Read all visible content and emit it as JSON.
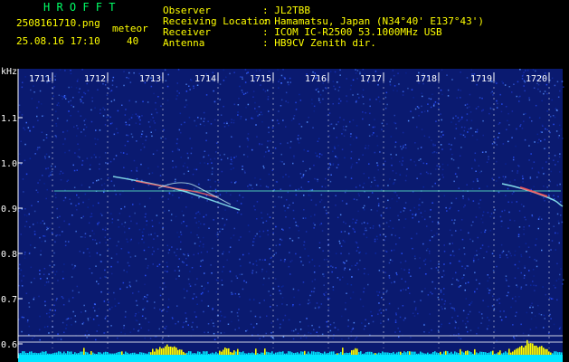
{
  "header": {
    "brand": "H R O F F T",
    "filename": "2508161710.png",
    "datetime": "25.08.16 17:10",
    "meteor_label": "meteor",
    "meteor_count": "40",
    "info": [
      {
        "key": "Observer",
        "value": ": JL2TBB"
      },
      {
        "key": "Receiving Location",
        "value": ": Hamamatsu, Japan (N34°40' E137°43')"
      },
      {
        "key": "Receiver",
        "value": ": ICOM IC-R2500 53.1000MHz USB"
      },
      {
        "key": "Antenna",
        "value": ": HB9CV Zenith dir."
      }
    ]
  },
  "axis": {
    "y_unit": "kHz",
    "y_ticks": [
      "1.1",
      "1.0",
      "0.9",
      "0.8",
      "0.7",
      "0.6"
    ],
    "x_ticks": [
      "1711",
      "1712",
      "1713",
      "1714",
      "1715",
      "1716",
      "1717",
      "1718",
      "1719",
      "1720"
    ]
  },
  "colors": {
    "header_green": "#00ff66",
    "header_yellow": "#ffff00",
    "plot_bg": "#0a1a70",
    "bars": "#00e5ff",
    "bar_peaks": "#ffff00",
    "grid": "#ffffff"
  }
}
